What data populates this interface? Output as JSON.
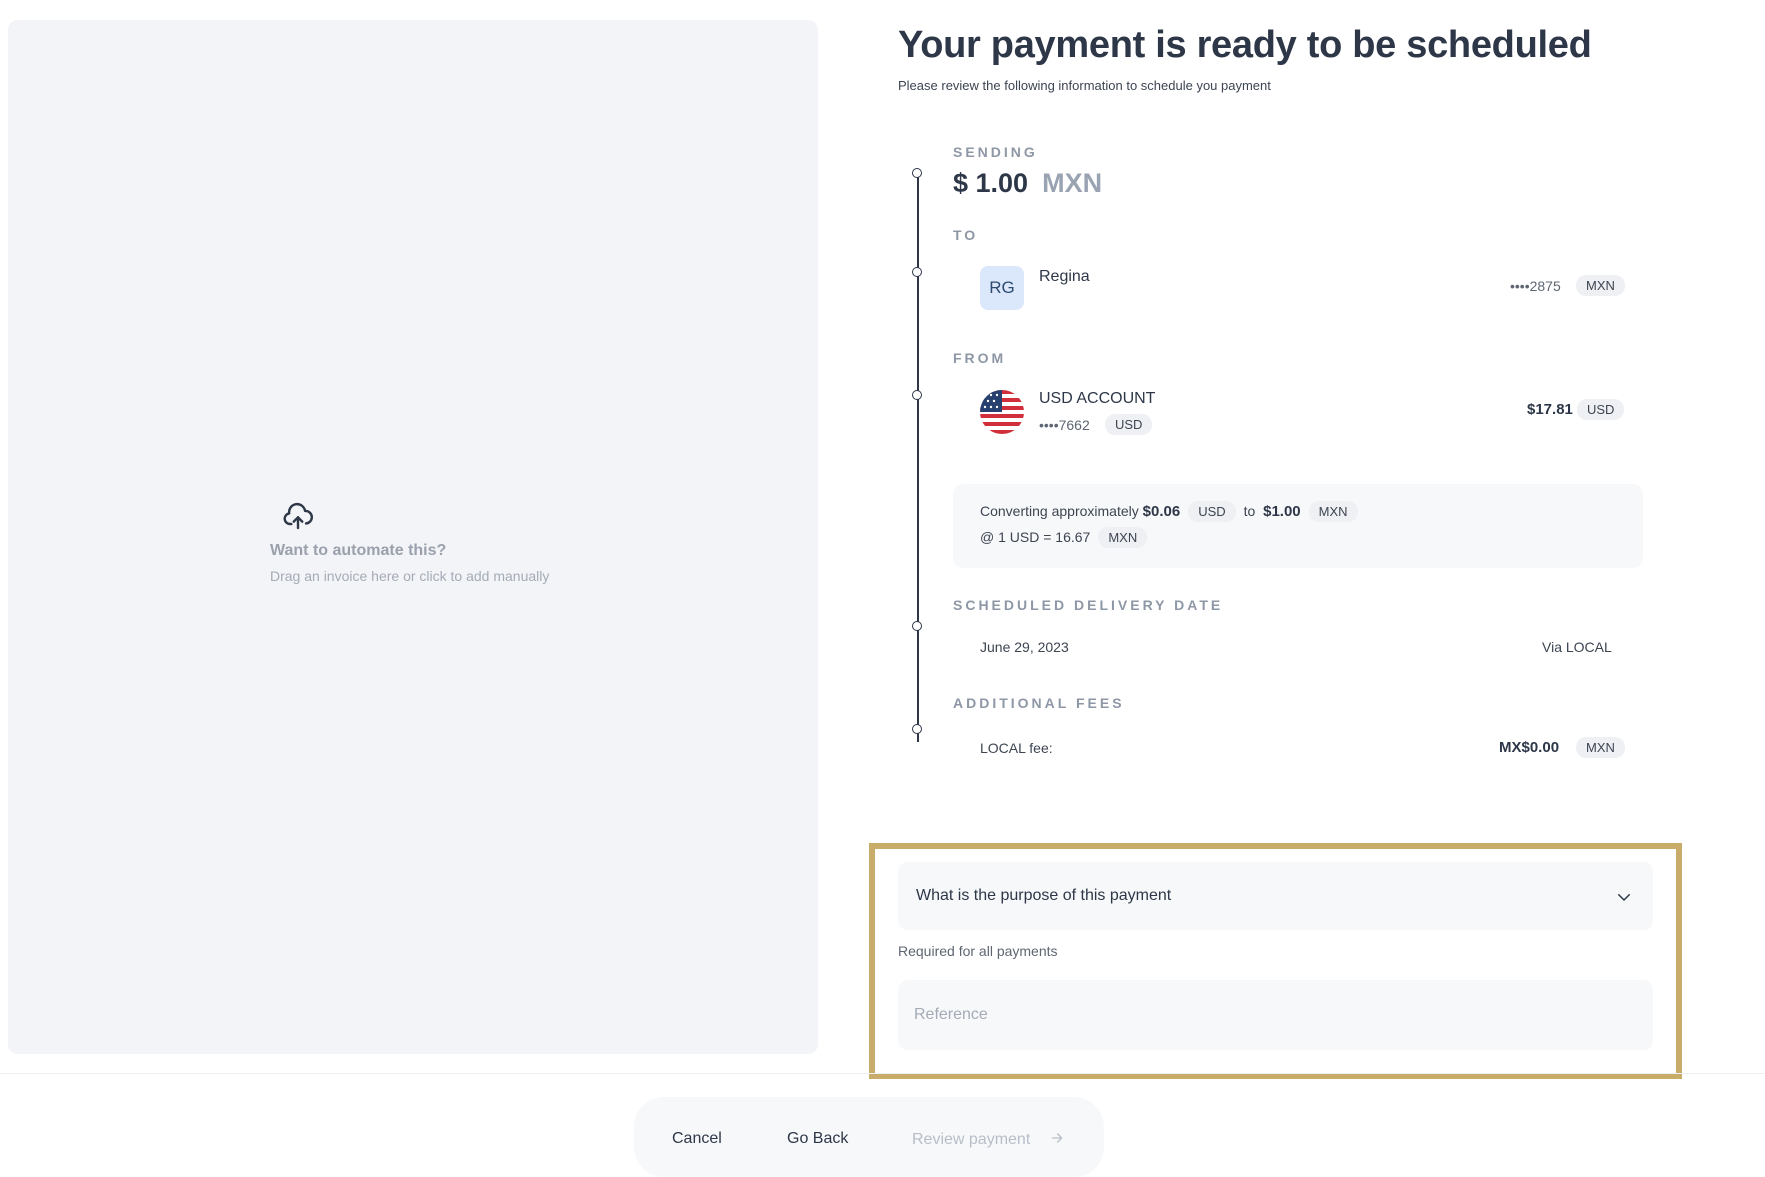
{
  "dropzone": {
    "icon": "upload-cloud-icon",
    "title": "Want to automate this?",
    "subtitle": "Drag an invoice here or click to add manually"
  },
  "header": {
    "title": "Your payment is ready to be scheduled",
    "subtitle": "Please review the following information to schedule you payment"
  },
  "sending": {
    "label": "SENDING",
    "amount": "$ 1.00",
    "currency": "MXN"
  },
  "to": {
    "label": "TO",
    "initials": "RG",
    "name": "Regina",
    "masked_account": "••••2875",
    "currency": "MXN"
  },
  "from": {
    "label": "FROM",
    "account_name": "USD ACCOUNT",
    "masked_account": "••••7662",
    "account_currency": "USD",
    "balance": "$17.81",
    "balance_currency": "USD",
    "flag": "us-flag-icon"
  },
  "conversion": {
    "prefix": "Converting approximately",
    "from_amount": "$0.06",
    "from_currency": "USD",
    "to_word": "to",
    "to_amount": "$1.00",
    "to_currency": "MXN",
    "rate_text": "@ 1 USD = 16.67",
    "rate_currency": "MXN"
  },
  "delivery": {
    "label": "SCHEDULED DELIVERY DATE",
    "date": "June 29, 2023",
    "via": "Via LOCAL"
  },
  "fees": {
    "label": "ADDITIONAL FEES",
    "fee_label": "LOCAL fee:",
    "fee_amount": "MX$0.00",
    "fee_currency": "MXN"
  },
  "form": {
    "purpose_placeholder": "What is the purpose of this payment",
    "required_note": "Required for all payments",
    "reference_placeholder": "Reference"
  },
  "footer": {
    "cancel": "Cancel",
    "go_back": "Go Back",
    "review": "Review payment"
  },
  "colors": {
    "highlight": "#c8ad6a",
    "text": "#2d3748",
    "muted": "#8e97a6"
  }
}
